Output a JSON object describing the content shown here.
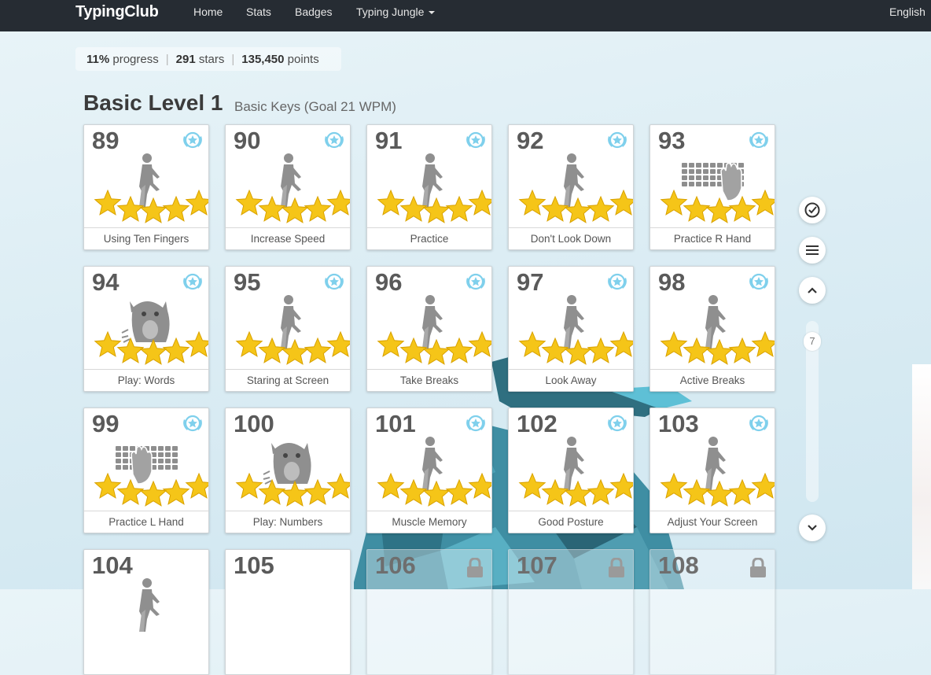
{
  "nav": {
    "brand": "TypingClub",
    "items": [
      "Home",
      "Stats",
      "Badges",
      "Typing Jungle"
    ],
    "language": "English"
  },
  "progress": {
    "percent": "11%",
    "percent_label": "progress",
    "stars": "291",
    "stars_label": "stars",
    "points": "135,450",
    "points_label": "points"
  },
  "level": {
    "title": "Basic Level 1",
    "subtitle": "Basic Keys (Goal 21 WPM)"
  },
  "lessons": [
    {
      "num": "89",
      "label": "Using Ten Fingers",
      "icon": "walking-person-icon",
      "stars": 5,
      "badge": true
    },
    {
      "num": "90",
      "label": "Increase Speed",
      "icon": "walking-person-icon",
      "stars": 5,
      "badge": true
    },
    {
      "num": "91",
      "label": "Practice",
      "icon": "walking-person-icon",
      "stars": 5,
      "badge": true
    },
    {
      "num": "92",
      "label": "Don't Look Down",
      "icon": "walking-person-icon",
      "stars": 5,
      "badge": true
    },
    {
      "num": "93",
      "label": "Practice R Hand",
      "icon": "keyboard-right-hand-icon",
      "stars": 5,
      "badge": true
    },
    {
      "num": "94",
      "label": "Play: Words",
      "icon": "monster-game-icon",
      "stars": 5,
      "badge": true
    },
    {
      "num": "95",
      "label": "Staring at Screen",
      "icon": "walking-person-icon",
      "stars": 5,
      "badge": true
    },
    {
      "num": "96",
      "label": "Take Breaks",
      "icon": "walking-person-icon",
      "stars": 5,
      "badge": true
    },
    {
      "num": "97",
      "label": "Look Away",
      "icon": "walking-person-icon",
      "stars": 5,
      "badge": true
    },
    {
      "num": "98",
      "label": "Active Breaks",
      "icon": "walking-person-icon",
      "stars": 5,
      "badge": true
    },
    {
      "num": "99",
      "label": "Practice L Hand",
      "icon": "keyboard-left-hand-icon",
      "stars": 5,
      "badge": true
    },
    {
      "num": "100",
      "label": "Play: Numbers",
      "icon": "monster-game-icon",
      "stars": 5,
      "badge": false
    },
    {
      "num": "101",
      "label": "Muscle Memory",
      "icon": "walking-person-icon",
      "stars": 5,
      "badge": true
    },
    {
      "num": "102",
      "label": "Good Posture",
      "icon": "walking-person-icon",
      "stars": 5,
      "badge": true
    },
    {
      "num": "103",
      "label": "Adjust Your Screen",
      "icon": "walking-person-icon",
      "stars": 5,
      "badge": true
    },
    {
      "num": "104",
      "label": "",
      "icon": "walking-person-icon",
      "stars": 0,
      "badge": false,
      "locked": false
    },
    {
      "num": "105",
      "label": "",
      "icon": "",
      "stars": 0,
      "badge": false,
      "locked": false
    },
    {
      "num": "106",
      "label": "",
      "icon": "lock-icon",
      "stars": 0,
      "badge": false,
      "locked": true
    },
    {
      "num": "107",
      "label": "",
      "icon": "lock-icon",
      "stars": 0,
      "badge": false,
      "locked": true
    },
    {
      "num": "108",
      "label": "",
      "icon": "lock-icon",
      "stars": 0,
      "badge": false,
      "locked": true
    }
  ],
  "sidebar": {
    "page_indicator": "7",
    "buttons": [
      "check-circle-icon",
      "menu-icon",
      "chevron-up-icon",
      "chevron-down-icon"
    ]
  },
  "colors": {
    "navbar": "#262c33",
    "star": "#f5c518",
    "badge": "#7fd0ec"
  }
}
